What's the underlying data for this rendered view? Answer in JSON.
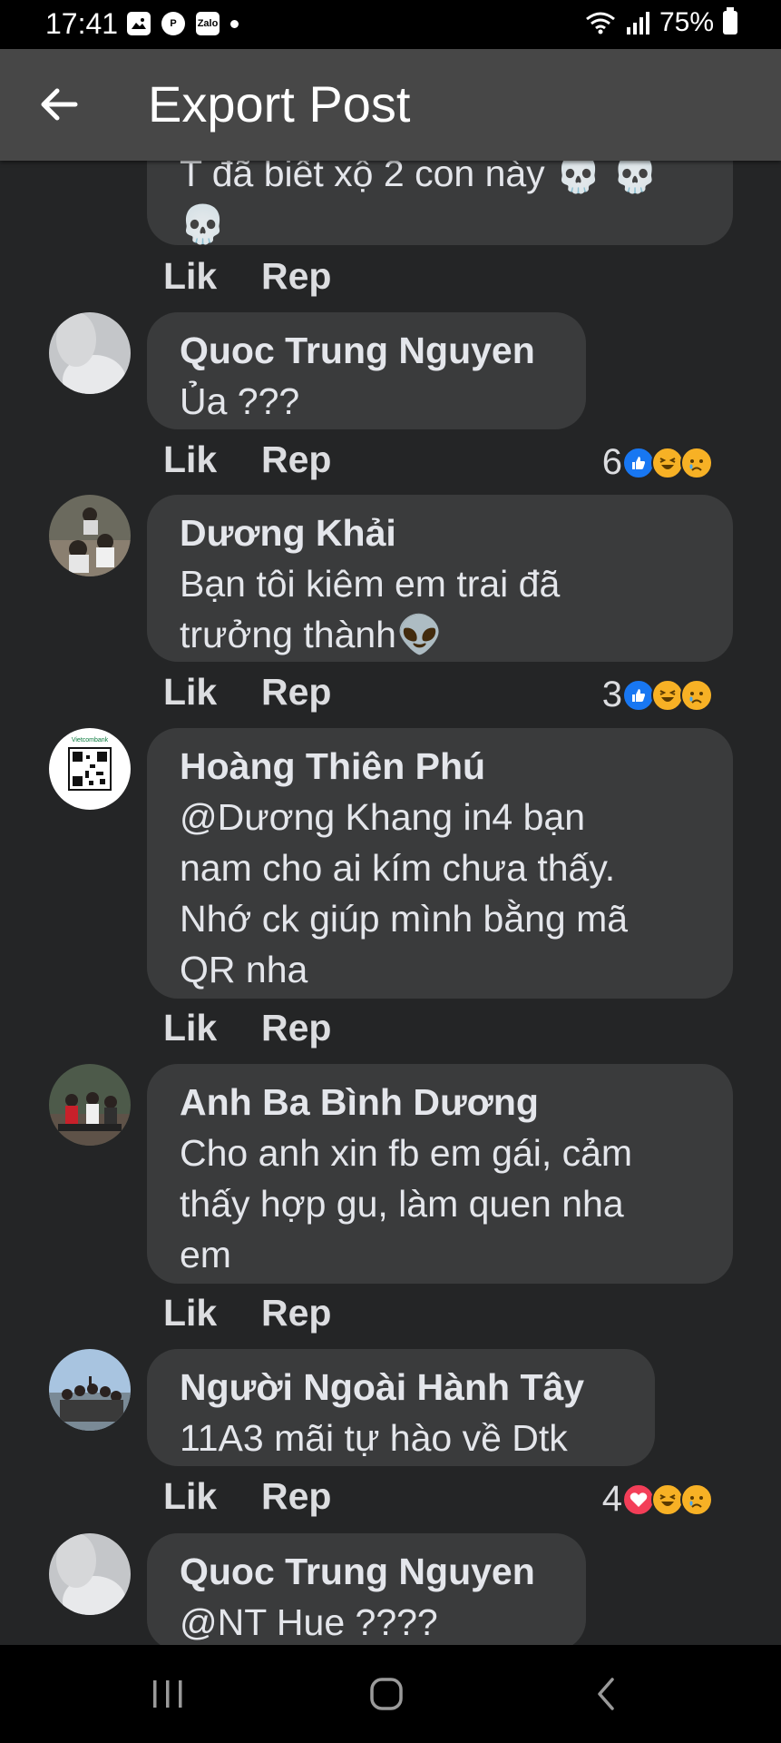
{
  "status_bar": {
    "time": "17:41",
    "battery": "75%",
    "app_icons": [
      "image-icon",
      "pinterest-icon",
      "zalo-icon"
    ],
    "zalo_label": "Zalo"
  },
  "app_bar": {
    "title": "Export Post"
  },
  "partial_comment": {
    "text": "T đã biết xộ 2 con này"
  },
  "actions": {
    "like": "Lik",
    "reply": "Rep"
  },
  "comments": [
    {
      "author": "Quoc Trung Nguyen",
      "lines": [
        "Ủa ???"
      ],
      "reaction_count": "6",
      "reactions": [
        "like",
        "haha",
        "sad"
      ]
    },
    {
      "author": "Dương Khải",
      "lines": [
        "Bạn tôi kiêm em trai đã",
        "trưởng thành"
      ],
      "reaction_count": "3",
      "reactions": [
        "like",
        "haha",
        "sad"
      ]
    },
    {
      "author": "Hoàng Thiên Phú",
      "lines": [
        "@Dương Khang in4 bạn",
        "nam cho ai kím chưa thấy.",
        "Nhớ ck giúp mình bằng mã",
        "QR nha"
      ],
      "reaction_count": "",
      "reactions": []
    },
    {
      "author": "Anh Ba Bình Dương",
      "lines": [
        "Cho anh xin fb em gái, cảm",
        "thấy hợp gu, làm quen nha",
        "em"
      ],
      "reaction_count": "",
      "reactions": []
    },
    {
      "author": "Người Ngoài Hành Tây",
      "lines": [
        "11A3 mãi tự hào về Dtk"
      ],
      "reaction_count": "4",
      "reactions": [
        "love",
        "haha",
        "sad"
      ]
    },
    {
      "author": "Quoc Trung Nguyen",
      "lines": [
        "@NT Hue ????"
      ],
      "reaction_count": "",
      "reactions": []
    }
  ],
  "avatar_labels": {
    "vietcombank": "Vietcombank"
  },
  "colors": {
    "background": "#242526",
    "bubble": "#3a3b3c",
    "app_bar": "#474747",
    "like_blue": "#1877f2",
    "love_red": "#f33e58",
    "haha_yellow": "#f7b125"
  }
}
